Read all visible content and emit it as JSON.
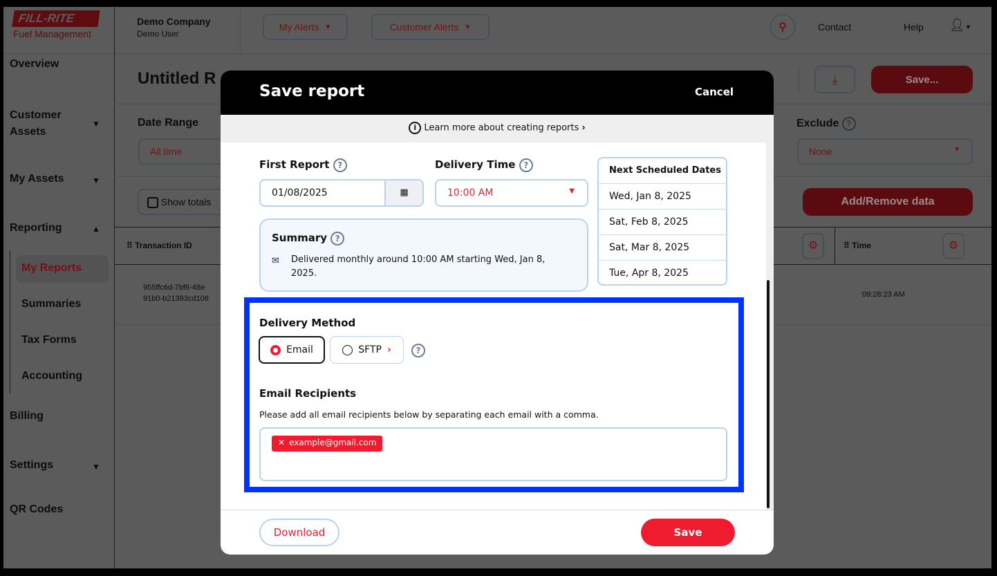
{
  "header": {
    "logo_top": "FILL-RITE",
    "logo_bottom": "Fuel Management",
    "company": "Demo Company",
    "user": "Demo User",
    "my_alerts": "My Alerts",
    "customer_alerts": "Customer Alerts",
    "contact": "Contact",
    "help": "Help"
  },
  "sidebar": {
    "items": [
      {
        "label": "Overview"
      },
      {
        "label": "Customer Assets"
      },
      {
        "label": "My Assets"
      },
      {
        "label": "Reporting"
      },
      {
        "label": "Billing"
      },
      {
        "label": "Settings"
      },
      {
        "label": "QR Codes"
      }
    ],
    "reporting_sub": [
      {
        "label": "My Reports",
        "active": true
      },
      {
        "label": "Summaries"
      },
      {
        "label": "Tax Forms"
      },
      {
        "label": "Accounting"
      }
    ]
  },
  "page": {
    "title": "Untitled R",
    "save_button": "Save...",
    "date_range_label": "Date Range",
    "date_range_value": "All time",
    "exclude_label": "Exclude",
    "exclude_value": "None",
    "show_totals": "Show totals",
    "add_remove": "Add/Remove data",
    "table": {
      "columns": [
        "Transaction ID",
        "Time"
      ],
      "rows": [
        {
          "id_line1": "955ffc6d-7bf6-48e",
          "id_line2": "91b0-b21393cd106",
          "time": "09:28:23 AM"
        }
      ]
    }
  },
  "modal": {
    "title": "Save report",
    "cancel": "Cancel",
    "learn_more": "Learn more about creating reports",
    "first_report_label": "First Report",
    "first_report_value": "01/08/2025",
    "delivery_time_label": "Delivery Time",
    "delivery_time_value": "10:00 AM",
    "next_dates_header": "Next Scheduled Dates",
    "next_dates": [
      "Wed, Jan 8, 2025",
      "Sat, Feb 8, 2025",
      "Sat, Mar 8, 2025",
      "Tue, Apr 8, 2025"
    ],
    "summary_label": "Summary",
    "summary_text": "Delivered monthly around 10:00 AM starting Wed, Jan 8, 2025.",
    "delivery_method_label": "Delivery Method",
    "methods": [
      {
        "label": "Email",
        "selected": true
      },
      {
        "label": "SFTP",
        "selected": false
      }
    ],
    "recipients_label": "Email Recipients",
    "recipients_help": "Please add all email recipients below by separating each email with a comma.",
    "recipients": [
      "example@gmail.com"
    ],
    "download": "Download",
    "save": "Save"
  },
  "colors": {
    "accent": "#ee1c2e",
    "highlight": "#0033ff",
    "border": "#b9d3ee"
  }
}
